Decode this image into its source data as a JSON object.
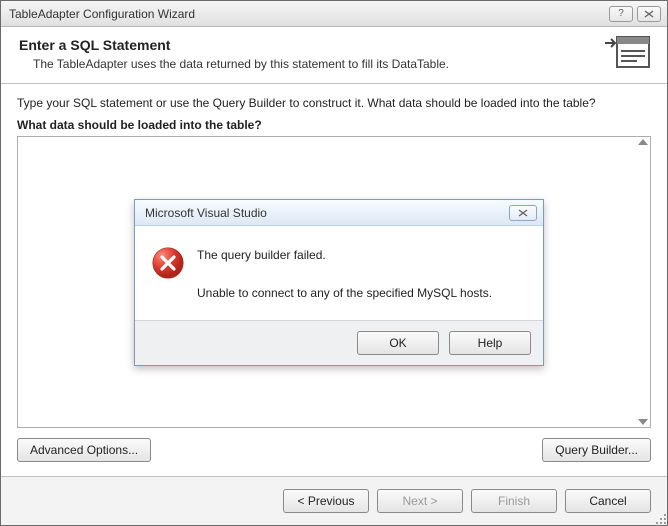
{
  "window": {
    "title": "TableAdapter Configuration Wizard"
  },
  "header": {
    "title": "Enter a SQL Statement",
    "subtitle": "The TableAdapter uses the data returned by this statement to fill its DataTable."
  },
  "body": {
    "instruction": "Type your SQL statement or use the Query Builder to construct it. What data should be loaded into the table?",
    "question": "What data should be loaded into the table?",
    "sql_value": ""
  },
  "buttons": {
    "advanced": "Advanced Options...",
    "query_builder": "Query Builder...",
    "previous": "< Previous",
    "next": "Next >",
    "finish": "Finish",
    "cancel": "Cancel"
  },
  "modal": {
    "title": "Microsoft Visual Studio",
    "line1": "The query builder failed.",
    "line2": "Unable to connect to any of the specified MySQL hosts.",
    "ok": "OK",
    "help": "Help"
  }
}
